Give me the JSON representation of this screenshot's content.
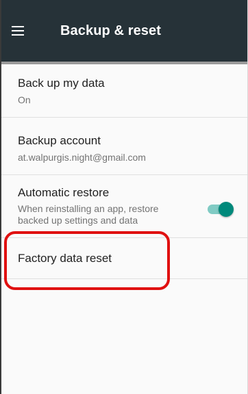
{
  "toolbar": {
    "title": "Backup & reset",
    "background": "#263238",
    "menu_icon": "hamburger-menu-icon"
  },
  "settings": [
    {
      "title": "Back up my data",
      "summary": "On"
    },
    {
      "title": "Backup account",
      "summary": "at.walpurgis.night@gmail.com"
    },
    {
      "title": "Automatic restore",
      "summary": "When reinstalling an app, restore backed up settings and data",
      "toggle_on": true
    },
    {
      "title": "Factory data reset"
    }
  ],
  "colors": {
    "accent": "#00897b",
    "highlight": "#e01010"
  }
}
